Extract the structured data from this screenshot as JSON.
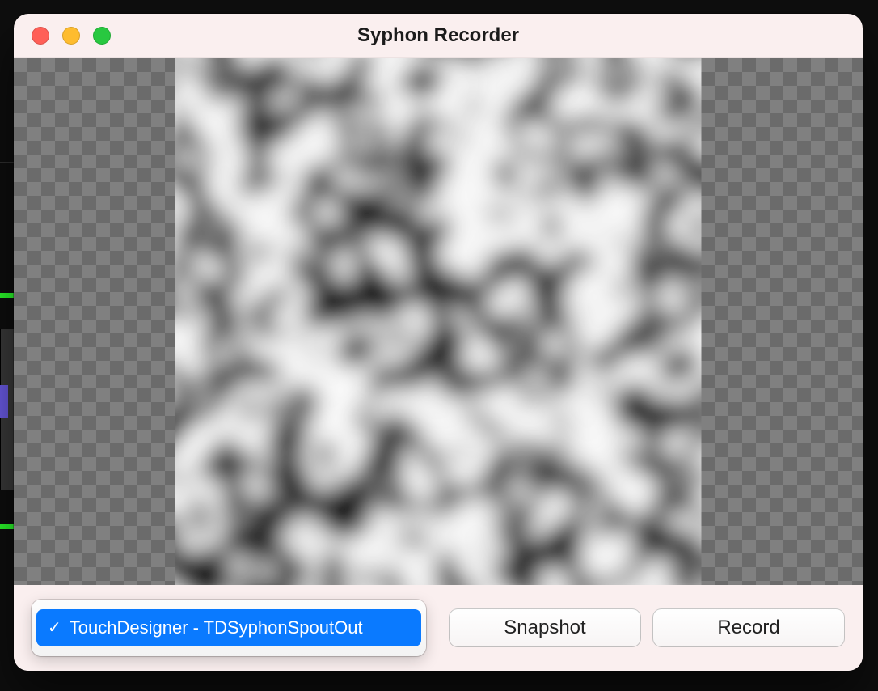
{
  "window": {
    "title": "Syphon Recorder"
  },
  "source": {
    "selected_label": "TouchDesigner - TDSyphonSpoutOut"
  },
  "buttons": {
    "snapshot": "Snapshot",
    "record": "Record"
  }
}
